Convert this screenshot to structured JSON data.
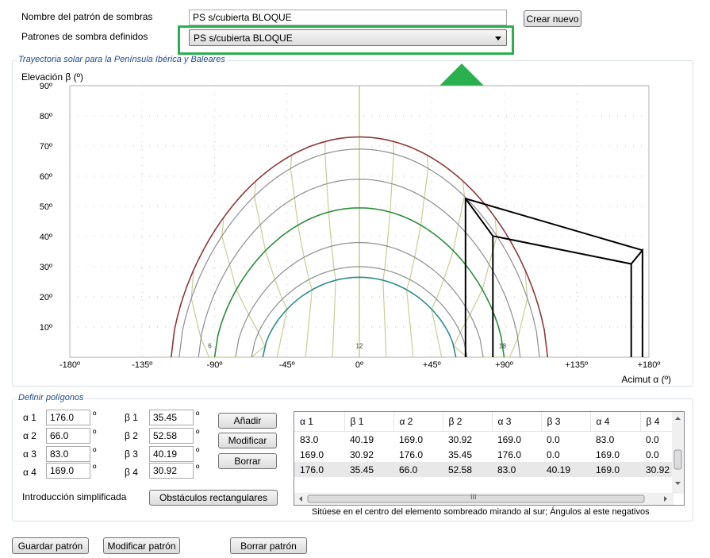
{
  "top": {
    "pattern_name_label": "Nombre del patrón de sombras",
    "pattern_name_value": "PS s/cubierta BLOQUE",
    "create_new_label": "Crear nuevo",
    "defined_patterns_label": "Patrones de sombra definidos",
    "defined_patterns_selected": "PS s/cubierta BLOQUE"
  },
  "chart_group": {
    "title": "Trayectoria solar para la Península Ibérica y Baleares"
  },
  "chart_data": {
    "type": "line",
    "ylabel": "Elevación β (º)",
    "xlabel": "Acimut α (º)",
    "x_ticks": [
      "-180º",
      "-135º",
      "-90º",
      "-45º",
      "0º",
      "+45º",
      "+90º",
      "+135º",
      "+180º"
    ],
    "y_ticks": [
      "10º",
      "20º",
      "30º",
      "40º",
      "50º",
      "60º",
      "70º",
      "80º",
      "90º"
    ],
    "xlim": [
      -180,
      180
    ],
    "ylim": [
      0,
      90
    ],
    "hour_labels": [
      {
        "text": "6",
        "x": -93,
        "y": 3
      },
      {
        "text": "12",
        "x": 0,
        "y": 3
      },
      {
        "text": "18",
        "x": 89,
        "y": 3
      }
    ],
    "colors": {
      "summer": "#8b3a3a",
      "equinox": "#2e8b3e",
      "winter": "#2e8b8e",
      "monthly": "#8e8e8e",
      "hour": "#c8cc96",
      "axis_center": "#b8c870"
    },
    "series": [
      {
        "kind": "summer",
        "peak": 73,
        "half_width": 117
      },
      {
        "kind": "monthly",
        "peak": 69,
        "half_width": 112
      },
      {
        "kind": "monthly",
        "peak": 59,
        "half_width": 100
      },
      {
        "kind": "equinox",
        "peak": 49.5,
        "half_width": 90
      },
      {
        "kind": "monthly",
        "peak": 38,
        "half_width": 77
      },
      {
        "kind": "monthly",
        "peak": 30,
        "half_width": 67
      },
      {
        "kind": "winter",
        "peak": 26.5,
        "half_width": 60
      }
    ],
    "obstacle_polygons": [
      [
        [
          66.0,
          52.58
        ],
        [
          83.0,
          40.19
        ],
        [
          83.0,
          0
        ]
      ],
      [
        [
          83.0,
          40.19
        ],
        [
          169.0,
          30.92
        ],
        [
          169.0,
          0
        ]
      ],
      [
        [
          169.0,
          30.92
        ],
        [
          176.0,
          35.45
        ],
        [
          176.0,
          0
        ]
      ],
      [
        [
          176.0,
          35.45
        ],
        [
          66.0,
          52.58
        ],
        [
          66.0,
          0
        ]
      ]
    ]
  },
  "polygons_group": {
    "title": "Definir polígonos"
  },
  "inputs": {
    "a1_label": "α 1",
    "a1_value": "176.0",
    "a2_label": "α 2",
    "a2_value": "66.0",
    "a3_label": "α 3",
    "a3_value": "83.0",
    "a4_label": "α 4",
    "a4_value": "169.0",
    "b1_label": "β 1",
    "b1_value": "35.45",
    "b2_label": "β 2",
    "b2_value": "52.58",
    "b3_label": "β 3",
    "b3_value": "40.19",
    "b4_label": "β 4",
    "b4_value": "30.92",
    "deg_symbol": "º"
  },
  "buttons": {
    "add": "Añadir",
    "modify": "Modificar",
    "delete": "Borrar",
    "rect_obstacles": "Obstáculos rectangulares",
    "save_pattern": "Guardar patrón",
    "modify_pattern": "Modificar patrón",
    "delete_pattern": "Borrar patrón"
  },
  "simplified_label": "Introducción simplificada",
  "table": {
    "columns": [
      "α 1",
      "β 1",
      "α 2",
      "β 2",
      "α 3",
      "β 3",
      "α 4",
      "β 4"
    ],
    "rows": [
      [
        "83.0",
        "40.19",
        "169.0",
        "30.92",
        "169.0",
        "0.0",
        "83.0",
        "0.0"
      ],
      [
        "169.0",
        "30.92",
        "176.0",
        "35.45",
        "176.0",
        "0.0",
        "169.0",
        "0.0"
      ],
      [
        "176.0",
        "35.45",
        "66.0",
        "52.58",
        "83.0",
        "40.19",
        "169.0",
        "30.92"
      ]
    ],
    "selected_row": 2,
    "hscroll_grip": "III"
  },
  "note": "Sitúese en el centro del elemento sombreado mirando al sur; Ángulos al este negativos"
}
